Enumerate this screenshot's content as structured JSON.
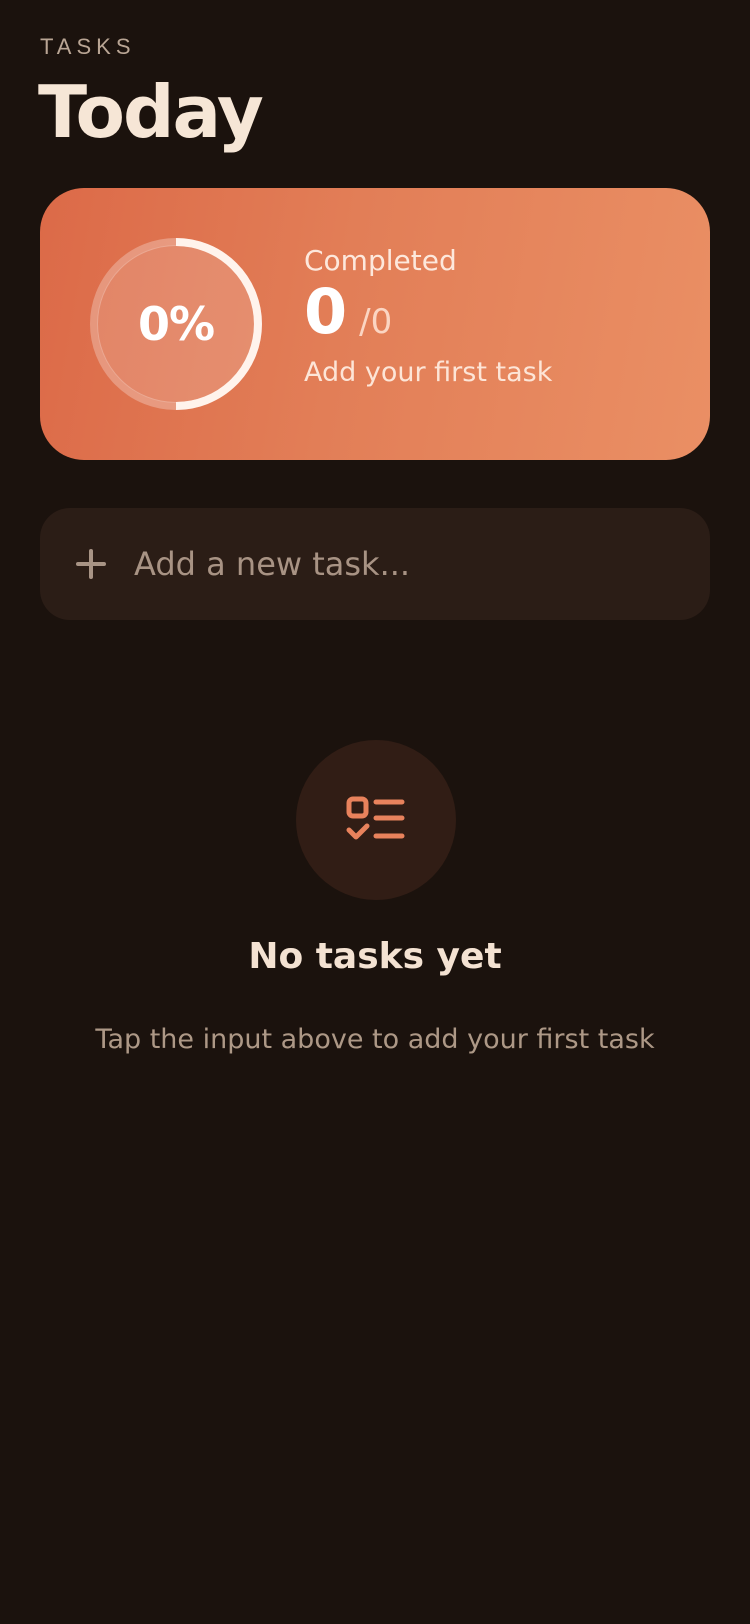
{
  "header": {
    "eyebrow": "TASKS",
    "title": "Today"
  },
  "progress": {
    "percent_label": "0%",
    "fraction": 0,
    "label": "Completed",
    "done": "0",
    "total": "/0",
    "subtitle": "Add your first task"
  },
  "add_task": {
    "placeholder": "Add a new task...",
    "icon": "plus-icon"
  },
  "empty_state": {
    "icon": "checklist-icon",
    "title": "No tasks yet",
    "subtitle": "Tap the input above to add your first task"
  },
  "colors": {
    "background": "#1b120d",
    "card_gradient_start": "#dc6a48",
    "card_gradient_end": "#ea8f64",
    "accent": "#e8825c",
    "input_bg": "#2b1d16"
  }
}
